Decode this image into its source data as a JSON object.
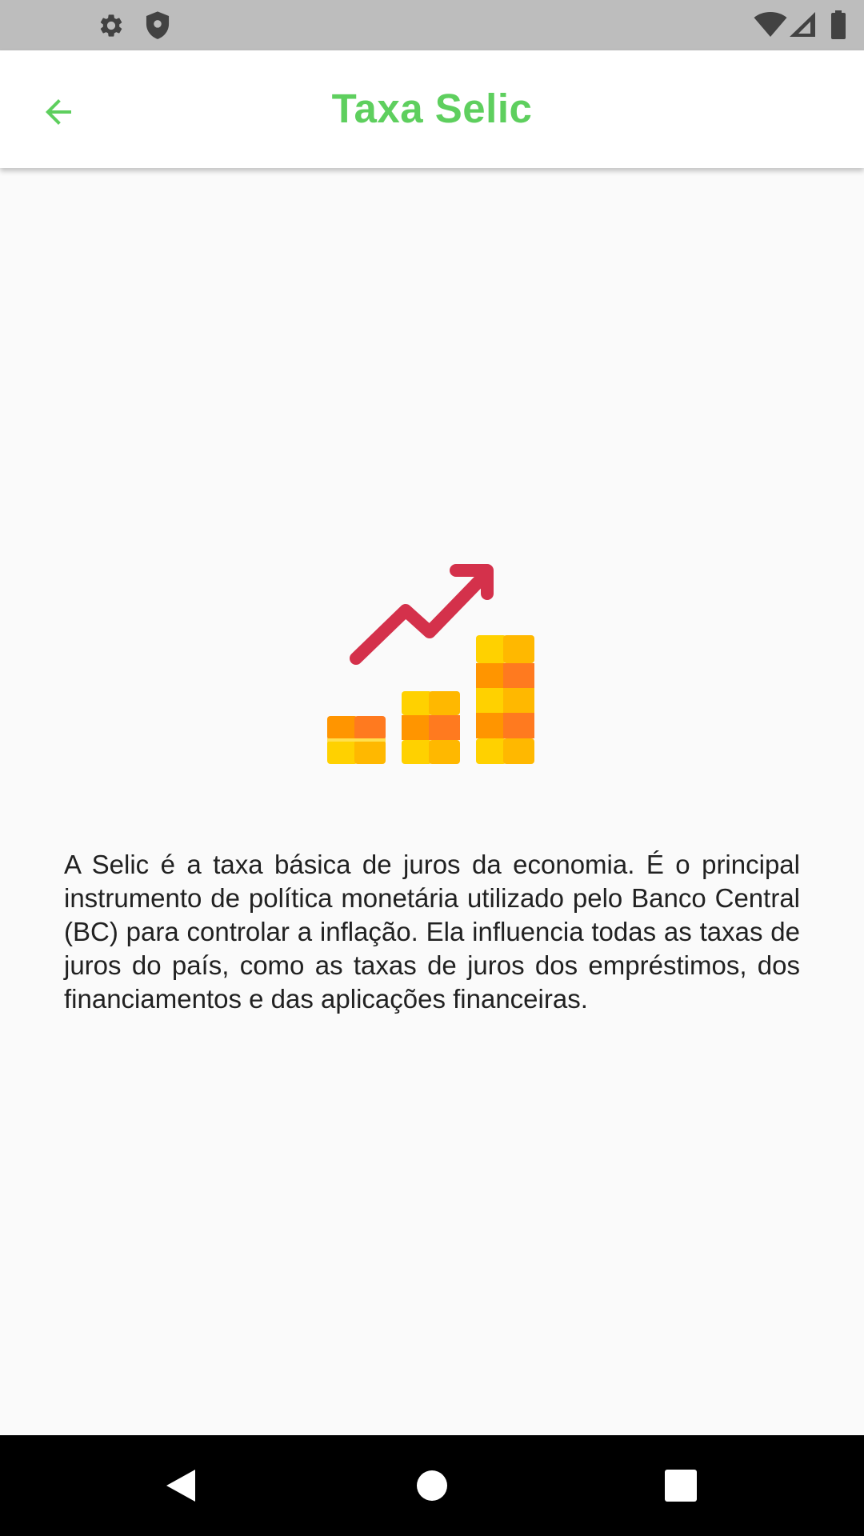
{
  "status_bar": {
    "left_icons": [
      "gear-icon",
      "shield-icon"
    ],
    "right_icons": [
      "wifi-icon",
      "cellular-signal-icon",
      "battery-icon"
    ]
  },
  "app_bar": {
    "title": "Taxa Selic",
    "back_icon": "arrow-back-icon"
  },
  "illustration": {
    "icon": "rising-coins-chart-icon"
  },
  "content": {
    "description": "A Selic é a taxa básica de juros da economia. É o principal instrumento de política monetária utilizado pelo Banco Central (BC) para controlar a inflação. Ela influencia todas as taxas de juros do país, como as taxas de juros dos empréstimos, dos financiamentos e das aplicações financeiras."
  },
  "nav_bar": {
    "buttons": [
      "back-triangle-icon",
      "home-circle-icon",
      "recents-square-icon"
    ]
  },
  "colors": {
    "accent": "#5ecf5e",
    "status_bar": "#bdbdbd",
    "status_icons": "#424242",
    "arrow_red": "#d4314b",
    "coin_yellow": "#ffd100",
    "coin_gold": "#ffb800",
    "coin_orange": "#ff9500",
    "coin_dark_orange": "#ff7a1f"
  }
}
